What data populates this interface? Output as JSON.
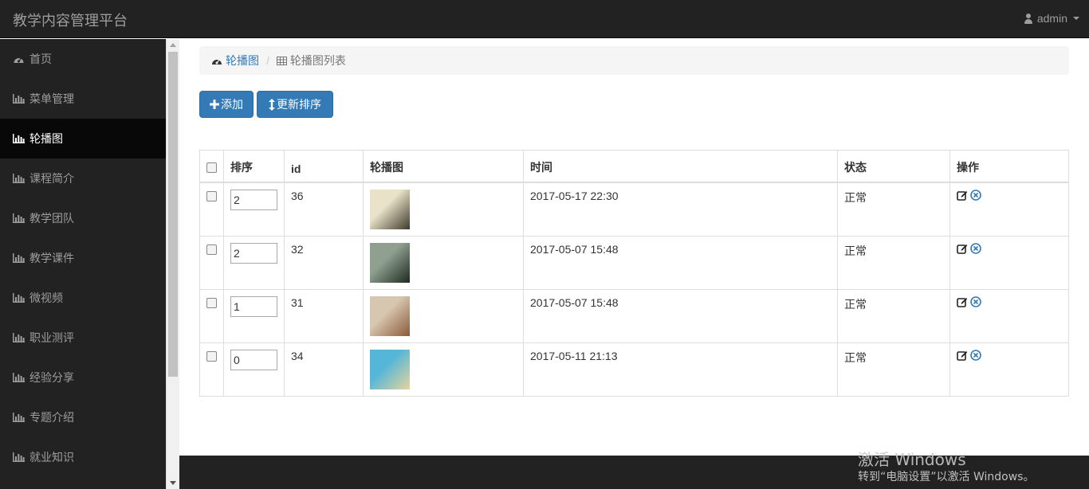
{
  "app": {
    "title": "教学内容管理平台",
    "user": "admin"
  },
  "sidebar": {
    "items": [
      {
        "label": "首页",
        "icon": "dashboard-icon",
        "active": false
      },
      {
        "label": "菜单管理",
        "icon": "bar-chart-icon",
        "active": false
      },
      {
        "label": "轮播图",
        "icon": "bar-chart-icon",
        "active": true
      },
      {
        "label": "课程简介",
        "icon": "bar-chart-icon",
        "active": false
      },
      {
        "label": "教学团队",
        "icon": "bar-chart-icon",
        "active": false
      },
      {
        "label": "教学课件",
        "icon": "bar-chart-icon",
        "active": false
      },
      {
        "label": "微视频",
        "icon": "bar-chart-icon",
        "active": false
      },
      {
        "label": "职业测评",
        "icon": "bar-chart-icon",
        "active": false
      },
      {
        "label": "经验分享",
        "icon": "bar-chart-icon",
        "active": false
      },
      {
        "label": "专题介绍",
        "icon": "bar-chart-icon",
        "active": false
      },
      {
        "label": "就业知识",
        "icon": "bar-chart-icon",
        "active": false
      }
    ]
  },
  "breadcrumb": {
    "link": "轮播图",
    "current": "轮播图列表"
  },
  "toolbar": {
    "add_label": "添加",
    "sort_label": "更新排序"
  },
  "table": {
    "headers": [
      "",
      "排序",
      "id",
      "轮播图",
      "时间",
      "状态",
      "操作"
    ],
    "rows": [
      {
        "order": "2",
        "id": "36",
        "time": "2017-05-17 22:30",
        "status": "正常",
        "thumb_colors": [
          "#e9e1c8",
          "#3c3a2c"
        ]
      },
      {
        "order": "2",
        "id": "32",
        "time": "2017-05-07 15:48",
        "status": "正常",
        "thumb_colors": [
          "#8fa090",
          "#1e2a1e"
        ]
      },
      {
        "order": "1",
        "id": "31",
        "time": "2017-05-07 15:48",
        "status": "正常",
        "thumb_colors": [
          "#d8c7b0",
          "#8a5a3a"
        ]
      },
      {
        "order": "0",
        "id": "34",
        "time": "2017-05-11 21:13",
        "status": "正常",
        "thumb_colors": [
          "#56b6d8",
          "#e6d59a"
        ]
      }
    ]
  },
  "watermark": {
    "line1": "激活 Windows",
    "line2": "转到“电脑设置”以激活 Windows。"
  },
  "colors": {
    "primary": "#337ab7",
    "nav_bg": "#222222",
    "active_bg": "#080808"
  }
}
